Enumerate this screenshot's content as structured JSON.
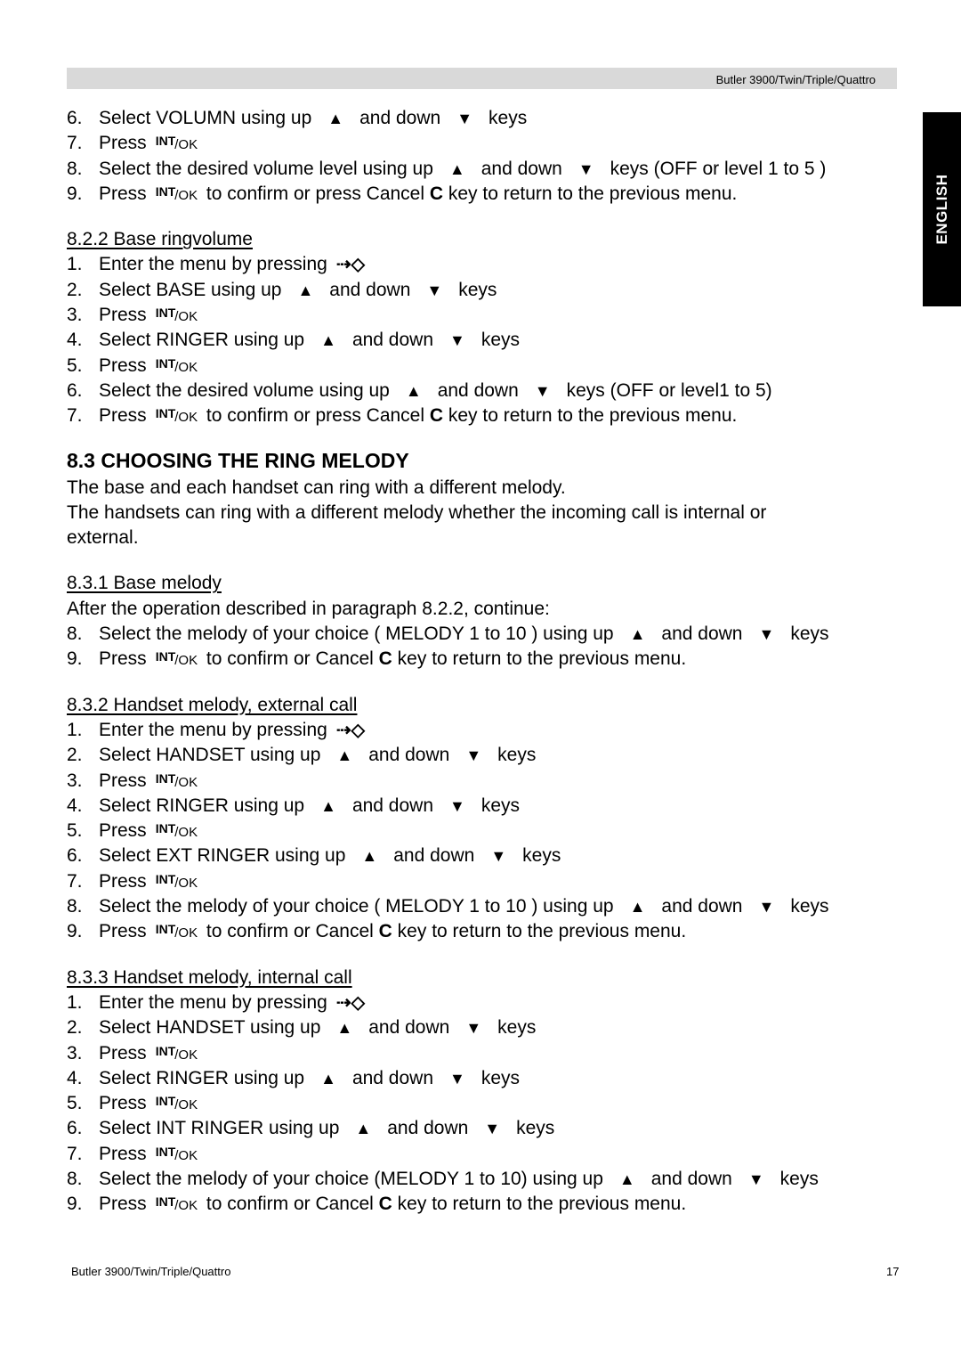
{
  "header": {
    "title": "Butler 3900/Twin/Triple/Quattro"
  },
  "language_tab": "ENGLISH",
  "keys": {
    "int": "INT",
    "ok": "/OK",
    "cancel": "C",
    "up_arrow": "▲",
    "down_arrow": "▼",
    "menu": "⇢◇"
  },
  "top_steps": [
    {
      "num": "6.",
      "pre": "Select VOLUMN using up",
      "mid": "and down",
      "post": "keys"
    },
    {
      "num": "7.",
      "press": "Press",
      "after": ""
    },
    {
      "num": "8.",
      "pre": "Select the desired volume level using up",
      "mid": "and down",
      "post": "keys (OFF or level 1 to 5 )"
    },
    {
      "num": "9.",
      "press": "Press",
      "after": "to confirm or press Cancel",
      "after2": "key to return to the previous menu."
    }
  ],
  "s822": {
    "title": "8.2.2  Base ringvolume",
    "steps": [
      {
        "num": "1.",
        "text": "Enter the menu by pressing"
      },
      {
        "num": "2.",
        "pre": "Select BASE using up",
        "mid": "and down",
        "post": "keys"
      },
      {
        "num": "3.",
        "press": "Press"
      },
      {
        "num": "4.",
        "pre": "Select RINGER using up",
        "mid": "and down",
        "post": "keys"
      },
      {
        "num": "5.",
        "press": "Press"
      },
      {
        "num": "6.",
        "pre": "Select the desired volume using up",
        "mid": "and down",
        "post": "keys (OFF or level1 to 5)"
      },
      {
        "num": "7.",
        "press": "Press",
        "after": "to confirm or press Cancel",
        "after2": "key to return to the previous menu."
      }
    ]
  },
  "s83": {
    "title": "8.3  CHOOSING THE RING MELODY",
    "para1": "The base and each handset can ring with a different melody.",
    "para2": "The handsets can ring with a different melody whether the incoming call is internal or",
    "para3": "external."
  },
  "s831": {
    "title": "8.3.1  Base melody",
    "intro": "After the operation described in paragraph 8.2.2, continue:",
    "steps": [
      {
        "num": "8.",
        "pre": "Select the melody of your choice ( MELODY 1 to 10 ) using up",
        "mid": "and down",
        "post": "keys"
      },
      {
        "num": "9.",
        "press": "Press",
        "after": "to confirm or Cancel",
        "after2": "key to return to the previous menu."
      }
    ]
  },
  "s832": {
    "title": "8.3.2  Handset melody, external call",
    "steps": [
      {
        "num": "1.",
        "text": "Enter the menu by pressing"
      },
      {
        "num": "2.",
        "pre": "Select HANDSET using up",
        "mid": "and down",
        "post": "keys"
      },
      {
        "num": "3.",
        "press": "Press"
      },
      {
        "num": "4.",
        "pre": "Select RINGER using up",
        "mid": "and down",
        "post": "keys"
      },
      {
        "num": "5.",
        "press": "Press"
      },
      {
        "num": "6.",
        "pre": "Select EXT RINGER using up",
        "mid": "and down",
        "post": "keys"
      },
      {
        "num": "7.",
        "press": "Press"
      },
      {
        "num": "8.",
        "pre": "Select the melody of your choice ( MELODY 1 to 10 ) using up",
        "mid": "and down",
        "post": "keys"
      },
      {
        "num": "9.",
        "press": "Press",
        "after": "to confirm or Cancel",
        "after2": "key to return to the previous menu."
      }
    ]
  },
  "s833": {
    "title": "8.3.3  Handset melody, internal call",
    "steps": [
      {
        "num": "1.",
        "text": "Enter the menu by pressing"
      },
      {
        "num": "2.",
        "pre": "Select HANDSET using up",
        "mid": "and down",
        "post": "keys"
      },
      {
        "num": "3.",
        "press": "Press"
      },
      {
        "num": "4.",
        "pre": "Select RINGER using up",
        "mid": "and down",
        "post": "keys"
      },
      {
        "num": "5.",
        "press": "Press"
      },
      {
        "num": "6.",
        "pre": "Select INT RINGER using up",
        "mid": "and down",
        "post": "keys"
      },
      {
        "num": "7.",
        "press": "Press"
      },
      {
        "num": "8.",
        "pre": "Select the melody of your choice (MELODY 1 to 10) using up",
        "mid": "and down",
        "post": "keys"
      },
      {
        "num": "9.",
        "press": "Press",
        "after": "to confirm or Cancel",
        "after2": "key  to return to the previous menu."
      }
    ]
  },
  "footer": {
    "title": "Butler 3900/Twin/Triple/Quattro",
    "page": "17"
  }
}
